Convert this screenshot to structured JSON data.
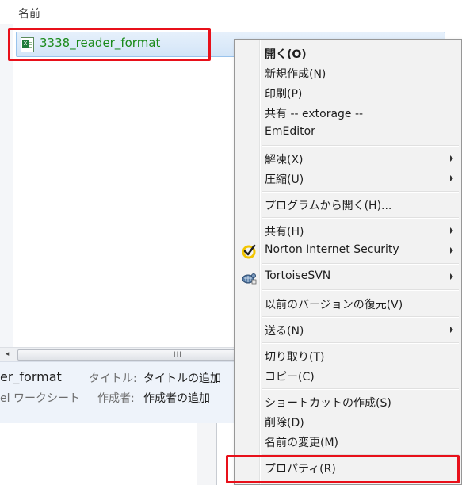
{
  "explorer": {
    "column_header_name": "名前",
    "file": {
      "name": "3338_reader_format",
      "icon": "excel-file-icon"
    },
    "scrollbar": {
      "left_arrow": "◂",
      "grip": "III"
    },
    "details": {
      "name_fragment": "er_format",
      "type_fragment": "el ワークシート",
      "title_label": "タイトル:",
      "title_value": "タイトルの追加",
      "author_label": "作成者:",
      "author_value": "作成者の追加"
    }
  },
  "context_menu": {
    "items": [
      {
        "label": "開く(O)",
        "bold": true
      },
      {
        "label": "新規作成(N)"
      },
      {
        "label": "印刷(P)"
      },
      {
        "label": "共有 -- extorage --"
      },
      {
        "label": "EmEditor"
      },
      {
        "label": "解凍(X)",
        "submenu": true
      },
      {
        "label": "圧縮(U)",
        "submenu": true
      },
      {
        "label": "プログラムから開く(H)..."
      },
      {
        "label": "共有(H)",
        "submenu": true
      },
      {
        "label": "Norton Internet Security",
        "submenu": true,
        "icon": "norton-check-icon"
      },
      {
        "label": "TortoiseSVN",
        "submenu": true,
        "icon": "tortoisesvn-icon"
      },
      {
        "label": "以前のバージョンの復元(V)"
      },
      {
        "label": "送る(N)",
        "submenu": true
      },
      {
        "label": "切り取り(T)"
      },
      {
        "label": "コピー(C)"
      },
      {
        "label": "ショートカットの作成(S)"
      },
      {
        "label": "削除(D)"
      },
      {
        "label": "名前の変更(M)"
      },
      {
        "label": "プロパティ(R)"
      }
    ]
  },
  "colors": {
    "highlight_box": "#e8101a",
    "file_name": "#1a8a1a",
    "norton_yellow": "#f2c500"
  }
}
